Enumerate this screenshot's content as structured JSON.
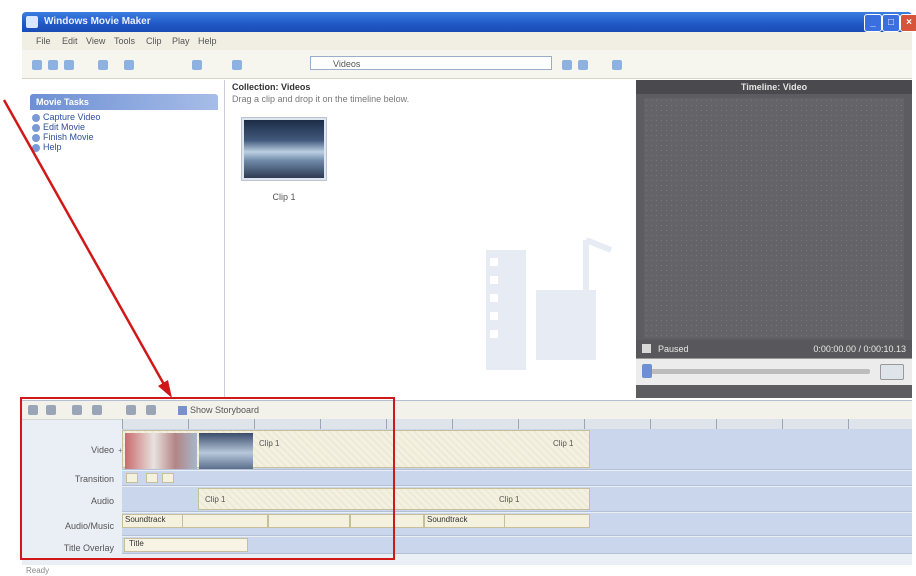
{
  "window": {
    "title": "Windows Movie Maker",
    "controls": {
      "minimize": "_",
      "maximize": "□",
      "close": "×"
    }
  },
  "menu": [
    "File",
    "Edit",
    "View",
    "Tools",
    "Clip",
    "Play",
    "Help"
  ],
  "toolbar": {
    "collection_value": "Videos"
  },
  "tasks": {
    "header": "Movie Tasks",
    "items": [
      "Capture Video",
      "Edit Movie",
      "Finish Movie",
      "Help"
    ]
  },
  "collection": {
    "title": "Collection: Videos",
    "hint": "Drag a clip and drop it on the timeline below.",
    "clips": [
      {
        "label": "Clip 1"
      }
    ]
  },
  "monitor": {
    "title": "Timeline: Video",
    "status_left": "Paused",
    "time": "0:00:00.00 / 0:00:10.13"
  },
  "timeline": {
    "storyboard_label": "Show Storyboard",
    "tracks": {
      "video": "Video",
      "transition": "Transition",
      "audio": "Audio",
      "audio_music": "Audio/Music",
      "title_overlay": "Title Overlay"
    },
    "clips": {
      "video_a": "Clip 1",
      "video_b": "Clip 1",
      "audio_a": "Clip 1",
      "audio_b": "Clip 1",
      "music_a": "Soundtrack",
      "music_b": "Soundtrack",
      "title": "Title"
    }
  },
  "status": {
    "text": "Ready"
  },
  "annotation": {
    "color": "#d01818"
  }
}
